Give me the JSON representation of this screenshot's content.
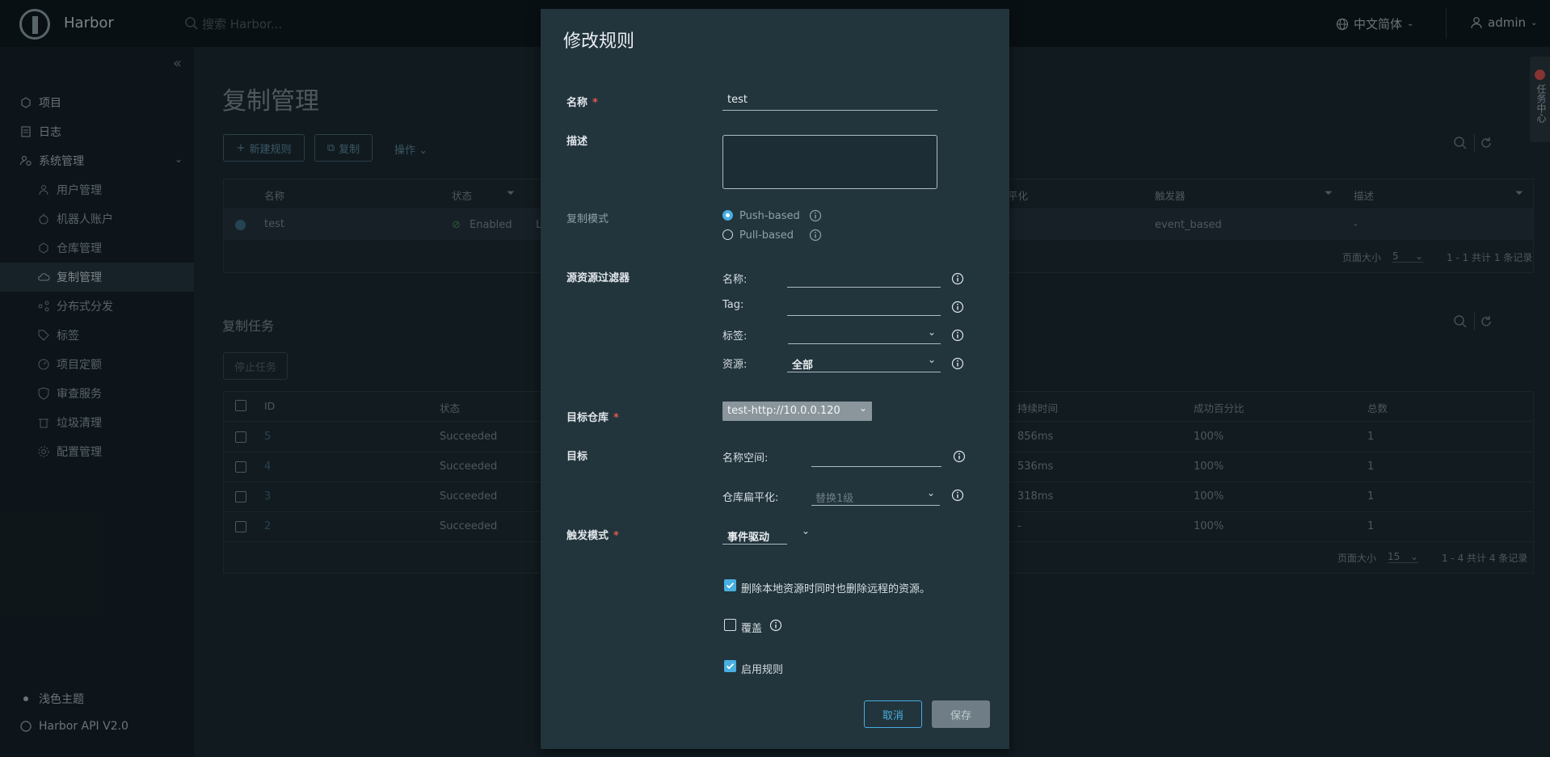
{
  "app": {
    "name": "Harbor",
    "search_placeholder": "搜索 Harbor...",
    "language": "中文简体",
    "user": "admin"
  },
  "sidebar": {
    "items": [
      {
        "label": "项目"
      },
      {
        "label": "日志"
      },
      {
        "label": "系统管理"
      }
    ],
    "sub_items": [
      {
        "label": "用户管理"
      },
      {
        "label": "机器人账户"
      },
      {
        "label": "仓库管理"
      },
      {
        "label": "复制管理"
      },
      {
        "label": "分布式分发"
      },
      {
        "label": "标签"
      },
      {
        "label": "项目定额"
      },
      {
        "label": "审查服务"
      },
      {
        "label": "垃圾清理"
      },
      {
        "label": "配置管理"
      }
    ],
    "theme": "浅色主题",
    "api": "Harbor API V2.0"
  },
  "main": {
    "title": "复制管理",
    "new_rule": "新建规则",
    "copy": "复制",
    "actions": "操作",
    "rules_table": {
      "headers": [
        "名称",
        "状态",
        "",
        "平化",
        "触发器",
        "描述"
      ],
      "row": {
        "name": "test",
        "status": "Enabled",
        "col3": "L",
        "trigger": "event_based",
        "desc": "-"
      },
      "page_size_label": "页面大小",
      "page_size": "5",
      "summary": "1 - 1 共计 1 条记录"
    },
    "tasks_title": "复制任务",
    "stop_task": "停止任务",
    "tasks_table": {
      "headers": [
        "ID",
        "状态",
        "持续时间",
        "成功百分比",
        "总数"
      ],
      "rows": [
        {
          "id": "5",
          "status": "Succeeded",
          "duration": "856ms",
          "pct": "100%",
          "total": "1"
        },
        {
          "id": "4",
          "status": "Succeeded",
          "duration": "536ms",
          "pct": "100%",
          "total": "1"
        },
        {
          "id": "3",
          "status": "Succeeded",
          "duration": "318ms",
          "pct": "100%",
          "total": "1"
        },
        {
          "id": "2",
          "status": "Succeeded",
          "duration": "-",
          "pct": "100%",
          "total": "1"
        }
      ],
      "page_size_label": "页面大小",
      "page_size": "15",
      "summary": "1 - 4 共计 4 条记录"
    }
  },
  "modal": {
    "title": "修改规则",
    "name_label": "名称",
    "name_value": "test",
    "desc_label": "描述",
    "mode_label": "复制模式",
    "push": "Push-based",
    "pull": "Pull-based",
    "filter_label": "源资源过滤器",
    "f_name": "名称:",
    "f_tag": "Tag:",
    "f_label": "标签:",
    "f_resource": "资源:",
    "f_resource_value": "全部",
    "target_repo_label": "目标仓库",
    "target_repo_value": "test-http://10.0.0.120",
    "target_label": "目标",
    "namespace": "名称空间:",
    "flatten": "仓库扁平化:",
    "flatten_placeholder": "替换1级",
    "trigger_label": "触发模式",
    "trigger_value": "事件驱动",
    "delete_remote": "删除本地资源时同时也删除远程的资源。",
    "override": "覆盖",
    "enable_rule": "启用规则",
    "cancel": "取消",
    "save": "保存"
  },
  "side_tab": "任务中心"
}
